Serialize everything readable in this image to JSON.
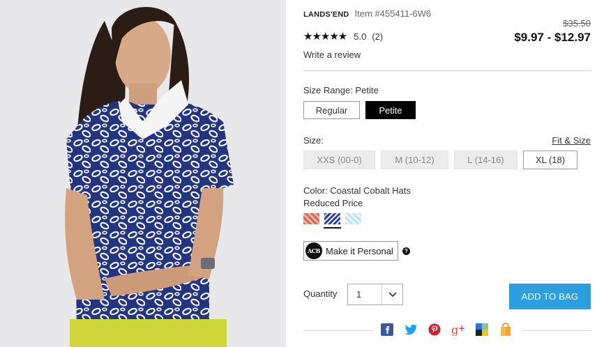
{
  "product": {
    "brand": "LANDS'END",
    "item_number": "Item #455411-6W6",
    "old_price": "$35.50",
    "price": "$9.97 - $12.97",
    "stars": "★★★★★",
    "rating": "5.0",
    "review_count": "(2)",
    "write_review": "Write a review"
  },
  "size_range": {
    "label": "Size Range: Petite",
    "options": [
      "Regular",
      "Petite"
    ],
    "selected": "Petite"
  },
  "size": {
    "label": "Size:",
    "fit_link": "Fit & Size",
    "options": [
      "XXS (00-0)",
      "M (10-12)",
      "L (14-16)",
      "XL (18)"
    ],
    "available": [
      "XL (18)"
    ]
  },
  "color": {
    "label": "Color: Coastal Cobalt Hats",
    "note": "Reduced Price",
    "swatches": [
      {
        "name": "coral-print"
      },
      {
        "name": "coastal-cobalt-hats",
        "selected": true
      },
      {
        "name": "light-blue-print"
      }
    ]
  },
  "personalize": {
    "monogram": "ACB",
    "label": "Make it Personal",
    "help": "?"
  },
  "quantity": {
    "label": "Quantity",
    "value": "1"
  },
  "cart": {
    "add_label": "ADD TO BAG"
  },
  "share": [
    "facebook-icon",
    "twitter-icon",
    "pinterest-icon",
    "google-plus-icon",
    "delicious-icon",
    "shopping-bag-icon"
  ],
  "colors": {
    "accent": "#2d9fde",
    "facebook": "#3b5998",
    "twitter": "#1da1f2",
    "pinterest": "#cb2027",
    "google": "#dd4b39",
    "bag": "#f5a623"
  }
}
